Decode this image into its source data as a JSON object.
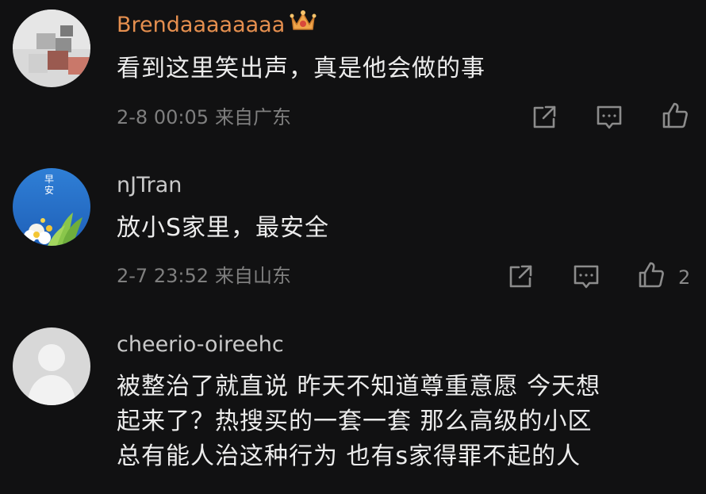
{
  "colors": {
    "background": "#111112",
    "vip_name": "#e58f4f",
    "name": "#c9c9c9",
    "meta": "#7f7f7f"
  },
  "comments": [
    {
      "username": "Brendaaaaaaaa",
      "badge_icon": "crown-icon",
      "text": "看到这里笑出声，真是他会做的事",
      "time": "2-8 00:05",
      "location": "来自广东",
      "likes": ""
    },
    {
      "username": "nJTran",
      "avatar_text": "早安",
      "text": "放小S家里，最安全",
      "time": "2-7 23:52",
      "location": "来自山东",
      "likes": "2"
    },
    {
      "username": "cheerio-oireehc",
      "text_lines": [
        "被整治了就直说 昨天不知道尊重意愿 今天想",
        "起来了？热搜买的一套一套 那么高级的小区",
        "总有能人治这种行为 也有s家得罪不起的人"
      ]
    }
  ]
}
